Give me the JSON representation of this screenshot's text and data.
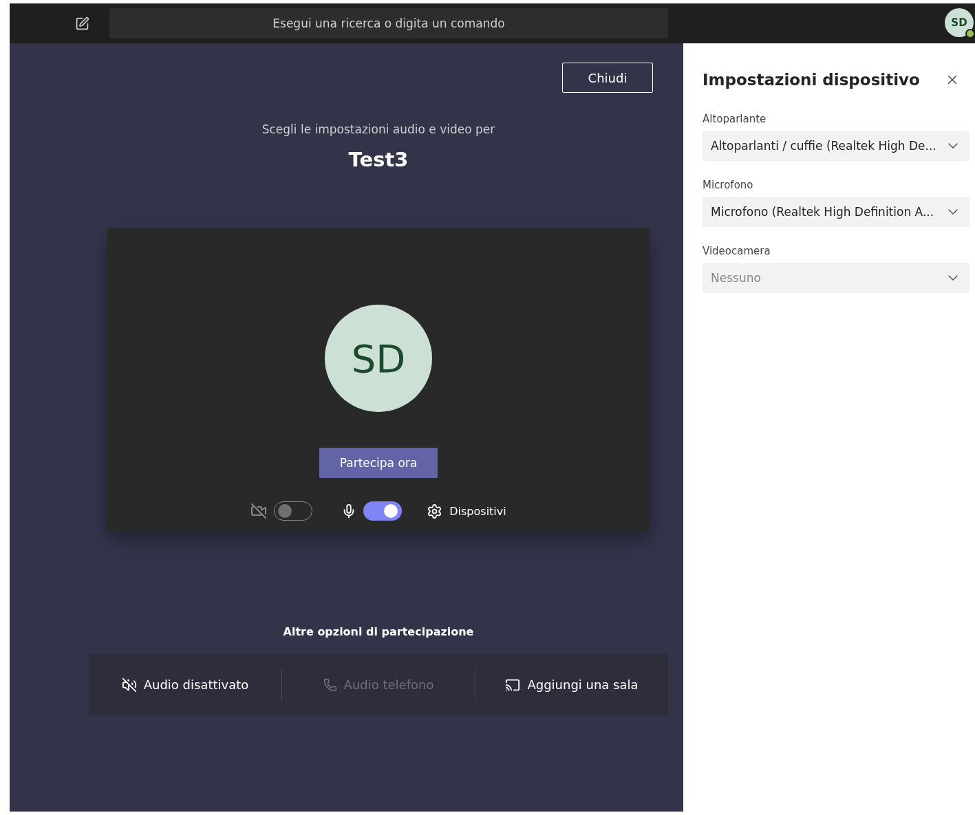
{
  "top_bar": {
    "search": {
      "placeholder": "Esegui una ricerca o digita un comando"
    },
    "avatar": {
      "initials": "SD"
    }
  },
  "pre_join": {
    "close_button": "Chiudi",
    "prompt": "Scegli le impostazioni audio e video per",
    "meeting_title": "Test3",
    "preview": {
      "avatar_initials": "SD"
    },
    "join_button": "Partecipa ora",
    "camera_toggle": {
      "on": false
    },
    "mic_toggle": {
      "on": true
    },
    "devices_button": "Dispositivi"
  },
  "other_options": {
    "title": "Altre opzioni di partecipazione",
    "items": [
      {
        "label": "Audio disattivato",
        "kind": "audio-off",
        "disabled": false
      },
      {
        "label": "Audio telefono",
        "kind": "phone",
        "disabled": true
      },
      {
        "label": "Aggiungi una sala",
        "kind": "room",
        "disabled": false
      }
    ]
  },
  "device_settings": {
    "title": "Impostazioni dispositivo",
    "fields": [
      {
        "label": "Altoparlante",
        "value": "Altoparlanti / cuffie (Realtek High De...",
        "disabled": false
      },
      {
        "label": "Microfono",
        "value": "Microfono (Realtek High Definition A...",
        "disabled": false
      },
      {
        "label": "Videocamera",
        "value": "Nessuno",
        "disabled": true
      }
    ]
  }
}
